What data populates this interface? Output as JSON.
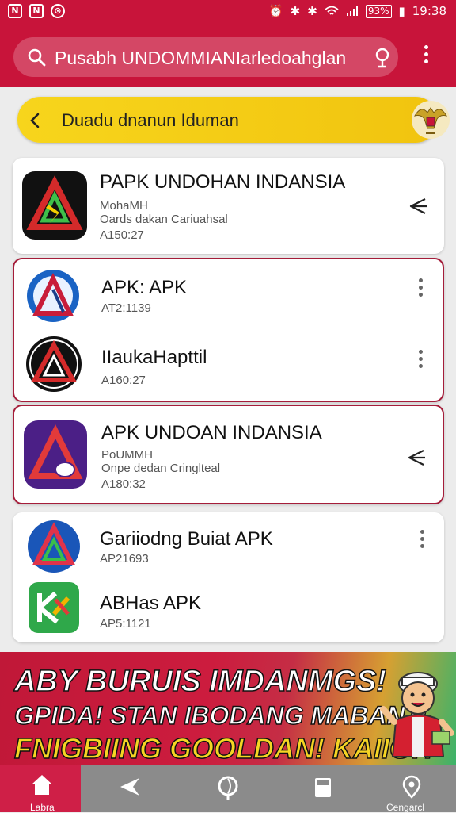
{
  "status_bar": {
    "time": "19:38",
    "battery": "93%"
  },
  "search": {
    "placeholder": "Pusabh UNDOMMIANIarledoahglan"
  },
  "banner": {
    "title": "Duadu dnanun Iduman"
  },
  "apps": [
    {
      "name": "PAPK UNDOHAN INDANSIA",
      "line1": "MohaMH",
      "line2": "Oards dakan Cariuahsal",
      "meta": "A150:27",
      "action": "share"
    },
    {
      "name": "APK: APK",
      "meta": "AT2:1139",
      "action": "more"
    },
    {
      "name": "IIaukaHapttil",
      "meta": "A160:27",
      "action": "more"
    },
    {
      "name": "APK  UNDOAN INDANSIA",
      "line1": "PoUMMH",
      "line2": "Onpe dedan Cringlteal",
      "meta": "A180:32",
      "action": "share"
    },
    {
      "name": "Gariiodng Buiat APK",
      "meta": "AP21693",
      "action": "more"
    },
    {
      "name": "ABHas APK",
      "meta": "AP5:1121",
      "action": "none"
    }
  ],
  "promo": {
    "line1": "ABY BURUIS IMDANMGS!",
    "line2": "GPIDA! STAN IBODANG MABANT:",
    "line3": "FNIGBIING GOOLDAN! KAIIG!?"
  },
  "nav": {
    "home": "Labra",
    "last": "Cengarcl"
  },
  "colors": {
    "primary": "#c8143a",
    "banner": "#f7d51c",
    "selected_border": "#a51d3a",
    "nav": "#8b8b8b"
  }
}
